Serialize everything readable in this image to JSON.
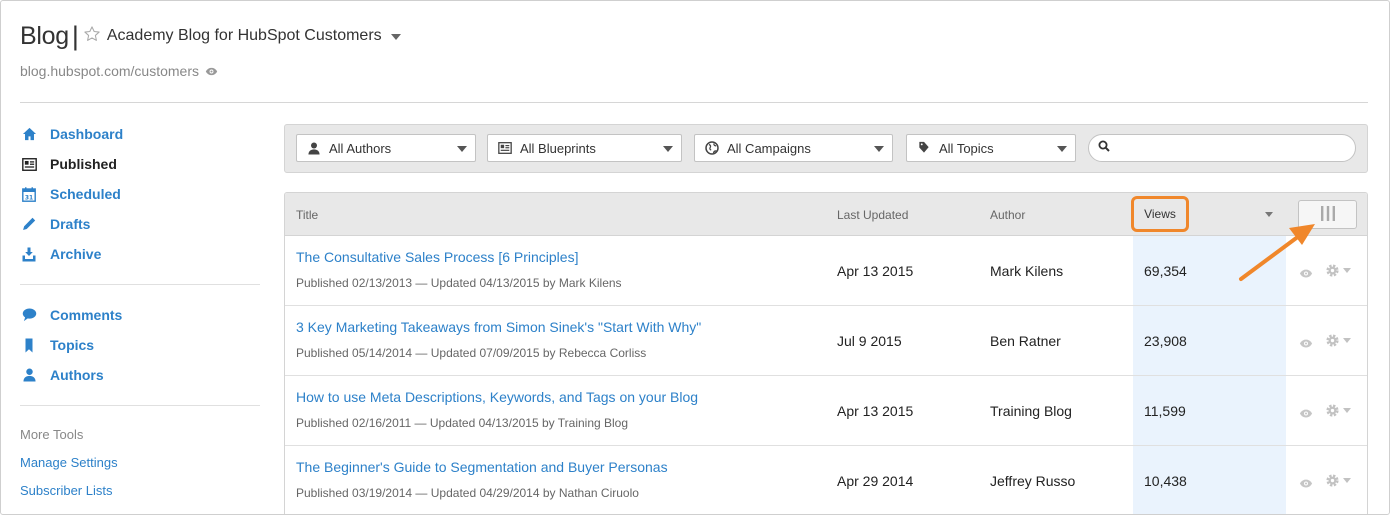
{
  "header": {
    "title": "Blog",
    "separator": "|",
    "blog_name": "Academy Blog for HubSpot Customers",
    "url": "blog.hubspot.com/customers"
  },
  "sidebar": {
    "primary": [
      {
        "label": "Dashboard",
        "icon": "home-icon"
      },
      {
        "label": "Published",
        "icon": "published-icon",
        "active": true
      },
      {
        "label": "Scheduled",
        "icon": "calendar-icon"
      },
      {
        "label": "Drafts",
        "icon": "pencil-icon"
      },
      {
        "label": "Archive",
        "icon": "archive-icon"
      }
    ],
    "secondary": [
      {
        "label": "Comments",
        "icon": "speech-bubble-icon"
      },
      {
        "label": "Topics",
        "icon": "bookmark-icon"
      },
      {
        "label": "Authors",
        "icon": "person-icon"
      }
    ],
    "more_tools_label": "More Tools",
    "tools": [
      "Manage Settings",
      "Subscriber Lists"
    ]
  },
  "filters": {
    "authors": "All Authors",
    "blueprints": "All Blueprints",
    "campaigns": "All Campaigns",
    "topics": "All Topics",
    "search_value": ""
  },
  "table": {
    "columns": {
      "title": "Title",
      "last_updated": "Last Updated",
      "author": "Author",
      "views": "Views"
    },
    "rows": [
      {
        "title": "The Consultative Sales Process [6 Principles]",
        "meta": "Published 02/13/2013 — Updated 04/13/2015 by Mark Kilens",
        "last_updated": "Apr 13 2015",
        "author": "Mark Kilens",
        "views": "69,354"
      },
      {
        "title": "3 Key Marketing Takeaways from Simon Sinek's \"Start With Why\"",
        "meta": "Published 05/14/2014 — Updated 07/09/2015 by Rebecca Corliss",
        "last_updated": "Jul 9 2015",
        "author": "Ben Ratner",
        "views": "23,908"
      },
      {
        "title": "How to use Meta Descriptions, Keywords, and Tags on your Blog",
        "meta": "Published 02/16/2011 — Updated 04/13/2015 by Training Blog",
        "last_updated": "Apr 13 2015",
        "author": "Training Blog",
        "views": "11,599"
      },
      {
        "title": "The Beginner's Guide to Segmentation and Buyer Personas",
        "meta": "Published 03/19/2014 — Updated 04/29/2014 by Nathan Ciruolo",
        "last_updated": "Apr 29 2014",
        "author": "Jeffrey Russo",
        "views": "10,438"
      }
    ]
  },
  "colors": {
    "link": "#2d81c9",
    "highlight": "#f0872b",
    "views_column": "#eaf3fd"
  }
}
